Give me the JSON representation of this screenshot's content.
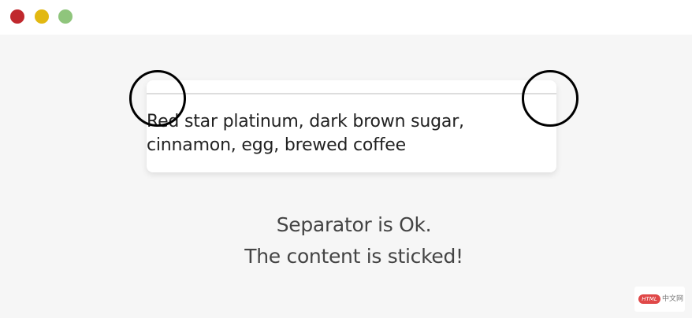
{
  "window": {
    "controls": [
      {
        "name": "close",
        "color": "#c0282d"
      },
      {
        "name": "minimize",
        "color": "#e2b811"
      },
      {
        "name": "maximize",
        "color": "#8fc57c"
      }
    ]
  },
  "card": {
    "text_line1": "Red star platinum, dark brown sugar,",
    "text_line2": "cinnamon, egg, brewed coffee"
  },
  "message": {
    "line1": "Separator is Ok.",
    "line2": "The content is sticked!"
  },
  "watermark": {
    "badge": "HTML",
    "text": "中文网"
  }
}
